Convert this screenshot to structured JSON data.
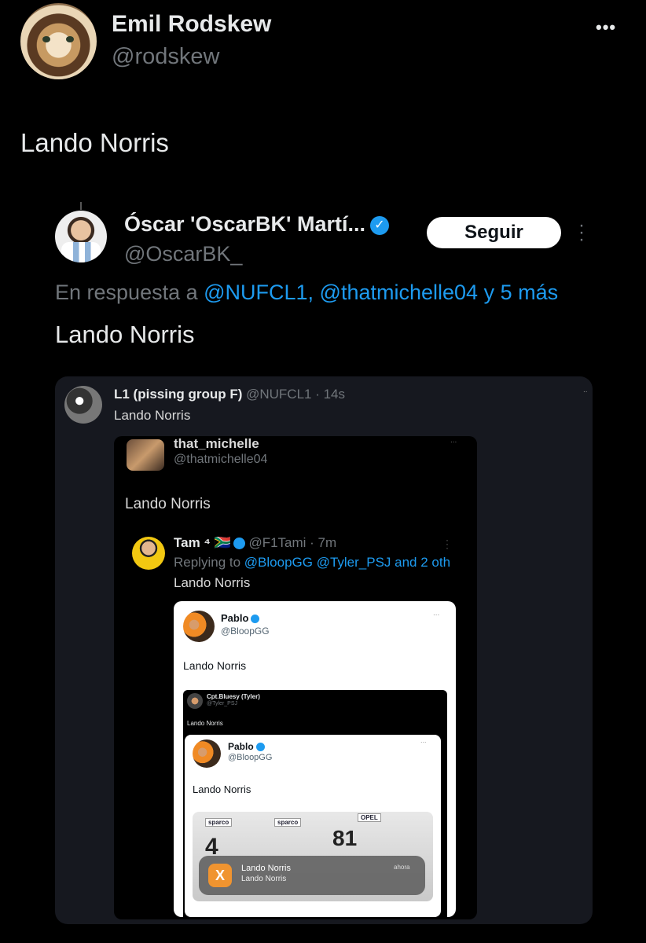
{
  "main_tweet": {
    "author_name": "Emil Rodskew",
    "author_handle": "@rodskew",
    "more_icon": "•••",
    "text": "Lando Norris",
    "avatar": "cat-avatar"
  },
  "quoted_tweet": {
    "author_name": "Óscar 'OscarBK' Martí...",
    "verified_icon": "✓",
    "author_handle": "@OscarBK_",
    "follow_label": "Seguir",
    "kebab_icon": "⋮",
    "reply_prefix": "En respuesta a ",
    "reply_targets": "@NUFCL1, @thatmichelle04 y 5 más",
    "text": "Lando Norris"
  },
  "screenshot": {
    "l1_name": "L1 (pissing group F)",
    "l1_handle": " @NUFCL1 · 14s",
    "l1_text": "Lando Norris",
    "l1_dots": "..",
    "michelle_name": "that_michelle",
    "michelle_handle": "@thatmichelle04",
    "michelle_dots": "...",
    "michelle_text": "Lando Norris",
    "tam_name": "Tam ⁴ 🇿🇦",
    "tam_handle": " @F1Tami · 7m",
    "tam_reply_prefix": "Replying to ",
    "tam_reply_targets": "@BloopGG @Tyler_PSJ and 2 oth",
    "tam_text": "Lando Norris",
    "tam_kebab": "⋮",
    "pablo_name": "Pablo",
    "pablo_handle": "@BloopGG",
    "pablo_dots": "...",
    "pablo_text": "Lando Norris",
    "cpt_name": "Cpt.Bluesy (Tyler)",
    "cpt_handle": "@Tyler_PSJ",
    "cpt_text": "Lando Norris",
    "pablo2_name": "Pablo",
    "pablo2_handle": "@BloopGG",
    "pablo2_dots": "...",
    "pablo2_text": "Lando Norris",
    "sponsor_1": "sparco",
    "sponsor_2": "sparco",
    "sponsor_3": "OPEL",
    "car_number_1": "4",
    "car_number_2": "81",
    "notification_icon": "X",
    "notification_title": "Lando Norris",
    "notification_body": "Lando Norris",
    "notification_time": "ahora"
  }
}
